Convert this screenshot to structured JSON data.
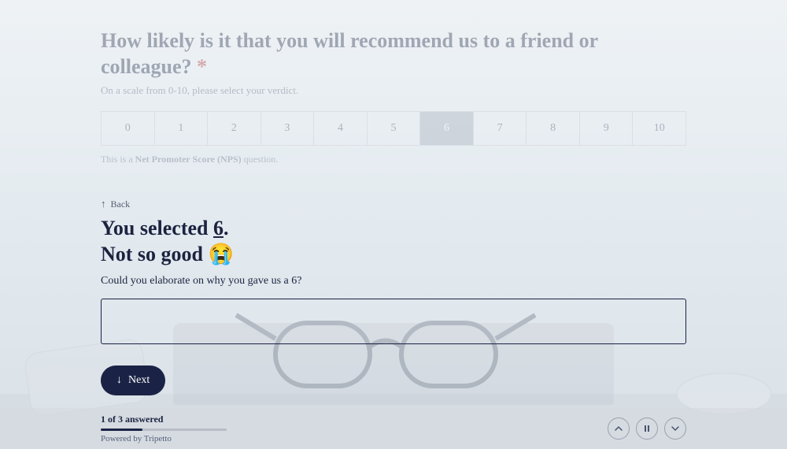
{
  "q1": {
    "title": "How likely is it that you will recommend us to a friend or colleague?",
    "required_mark": "*",
    "subtitle": "On a scale from 0-10, please select your verdict.",
    "scale": [
      "0",
      "1",
      "2",
      "3",
      "4",
      "5",
      "6",
      "7",
      "8",
      "9",
      "10"
    ],
    "selected_index": 6,
    "hint_prefix": "This is a ",
    "hint_strong": "Net Promoter Score (NPS)",
    "hint_suffix": " question."
  },
  "q2": {
    "back_label": "Back",
    "title_line1_pre": "You selected ",
    "title_line1_value": "6",
    "title_line1_post": ".",
    "title_line2": "Not so good 😭",
    "elaborate": "Could you elaborate on why you gave us a 6?",
    "next_label": "Next"
  },
  "footer": {
    "progress_text": "1 of 3 answered",
    "progress_fraction": 0.333,
    "powered": "Powered by Tripetto"
  }
}
